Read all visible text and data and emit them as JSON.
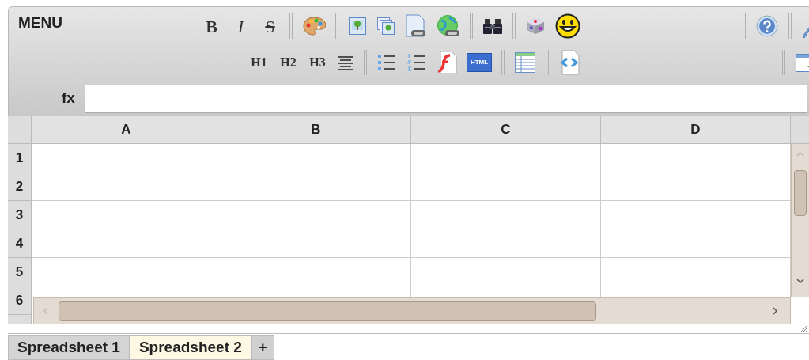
{
  "menu": {
    "label": "MENU"
  },
  "toolbar_rows": [
    {
      "items": [
        {
          "kind": "text",
          "label": "B"
        },
        {
          "kind": "text",
          "label": "I"
        },
        {
          "kind": "text",
          "label": "S"
        },
        {
          "kind": "separator"
        },
        {
          "kind": "icon"
        },
        {
          "kind": "separator"
        },
        {
          "kind": "icon"
        },
        {
          "kind": "icon"
        },
        {
          "kind": "icon"
        },
        {
          "kind": "icon"
        },
        {
          "kind": "separator"
        },
        {
          "kind": "icon"
        },
        {
          "kind": "separator"
        },
        {
          "kind": "icon"
        },
        {
          "kind": "icon"
        },
        {
          "kind": "spacer"
        },
        {
          "kind": "separator"
        },
        {
          "kind": "icon"
        },
        {
          "kind": "separator"
        },
        {
          "kind": "icon"
        }
      ]
    },
    {
      "items": [
        {
          "kind": "text",
          "label": "H1"
        },
        {
          "kind": "text",
          "label": "H2"
        },
        {
          "kind": "text",
          "label": "H3"
        },
        {
          "kind": "icon"
        },
        {
          "kind": "separator"
        },
        {
          "kind": "icon"
        },
        {
          "kind": "icon"
        },
        {
          "kind": "icon"
        },
        {
          "kind": "label_icon",
          "label": "HTML"
        },
        {
          "kind": "separator"
        },
        {
          "kind": "icon"
        },
        {
          "kind": "separator"
        },
        {
          "kind": "icon"
        },
        {
          "kind": "spacer"
        },
        {
          "kind": "separator"
        },
        {
          "kind": "icon"
        }
      ]
    }
  ],
  "formula_bar": {
    "label": "fx"
  },
  "sheet": {
    "columns": [
      "A",
      "B",
      "C",
      "D"
    ],
    "rows": [
      "1",
      "2",
      "3",
      "4",
      "5",
      "6"
    ]
  },
  "tabs": [
    {
      "label": "Spreadsheet 1",
      "selected": false
    },
    {
      "label": "Spreadsheet 2",
      "selected": true
    },
    {
      "label": "+",
      "kind": "add"
    }
  ]
}
